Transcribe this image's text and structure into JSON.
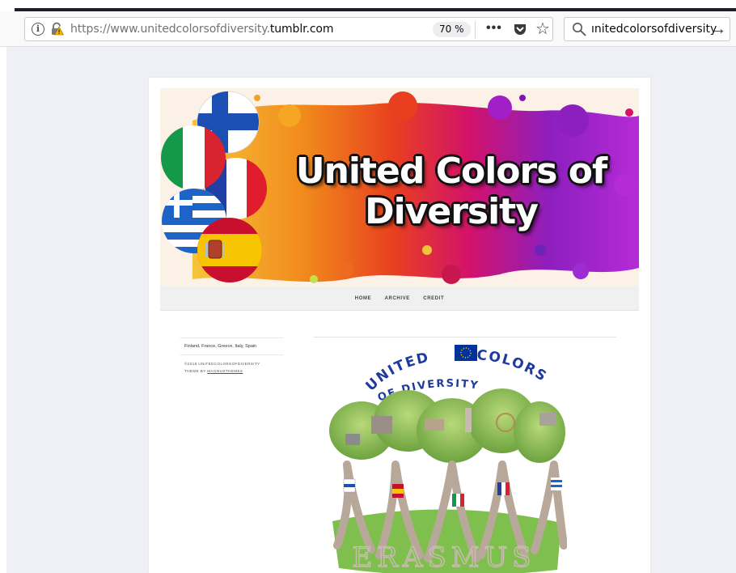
{
  "browser": {
    "url_prefix": "https://www.unitedcolorsofdiversity.",
    "url_domain": "tumblr.com",
    "zoom_level": "70 %",
    "search_value": "ınitedcolorsofdiversity",
    "icons": [
      "info-icon",
      "insecure-lock-icon",
      "page-actions-icon",
      "pocket-icon",
      "bookmark-star-icon",
      "search-icon",
      "go-arrow-icon"
    ]
  },
  "blog": {
    "banner_title_line1": "United Colors of",
    "banner_title_line2": "Diversity",
    "flags": [
      "Finland",
      "Italy",
      "France",
      "Greece",
      "Spain"
    ],
    "nav": [
      {
        "label": "HOME"
      },
      {
        "label": "ARCHIVE"
      },
      {
        "label": "CREDIT"
      }
    ],
    "sidebar": {
      "tags": "Finland, France, Greece, Italy, Spain",
      "copyright": "©2018 UNITEDCOLORSOFDIVERSITY",
      "theme_prefix": "THEME BY ",
      "theme_link": "MAGNUSTHEMES"
    },
    "post_logo": {
      "arc_left": "UNITED",
      "arc_right": "COLORS",
      "subtitle": "OF DIVERSITY",
      "ground_text": "ERASMUS"
    }
  },
  "colors": {
    "chrome_bg": "#f9f9fa",
    "page_bg": "#eef0f5",
    "logo_blue": "#1e3a9e",
    "eu_blue": "#003399",
    "eu_gold": "#ffcc00"
  }
}
